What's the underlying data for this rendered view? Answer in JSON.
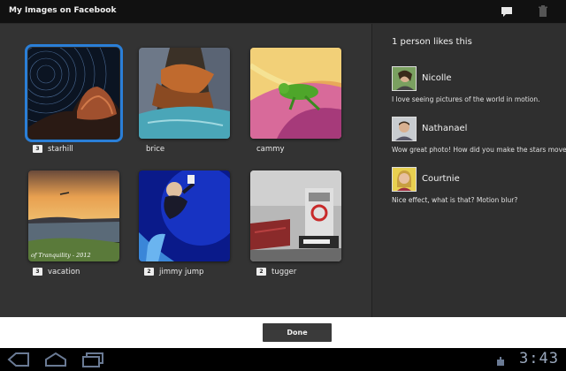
{
  "app": {
    "title": "My Images on Facebook"
  },
  "toolbar": {
    "comment_icon": "speech-bubble-icon",
    "delete_icon": "trash-icon"
  },
  "gallery": {
    "items": [
      {
        "caption": "starhill",
        "badge": "3",
        "selected": true
      },
      {
        "caption": "brice",
        "badge": ""
      },
      {
        "caption": "cammy",
        "badge": ""
      },
      {
        "caption": "vacation",
        "badge": "3"
      },
      {
        "caption": "jimmy jump",
        "badge": "2"
      },
      {
        "caption": "tugger",
        "badge": "2"
      }
    ],
    "overlay_text": "of Tranquility - 2012"
  },
  "comments": {
    "likes_label": "1 person likes this",
    "items": [
      {
        "name": "Nicolle",
        "text": "I love seeing pictures of the world in motion."
      },
      {
        "name": "Nathanael",
        "text": "Wow great photo! How did you make the stars move?!"
      },
      {
        "name": "Courtnie",
        "text": "Nice effect, what is that? Motion blur?"
      }
    ]
  },
  "footer": {
    "done_label": "Done"
  },
  "system": {
    "clock": "3:43"
  },
  "colors": {
    "selection": "#2a7fd8",
    "panel": "#333333",
    "background": "#000000"
  }
}
